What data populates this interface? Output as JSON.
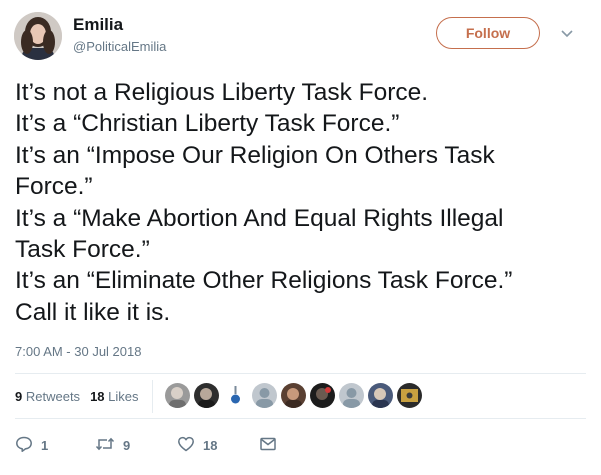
{
  "user": {
    "name": "Emilia",
    "handle": "@PoliticalEmilia"
  },
  "follow_label": "Follow",
  "tweet": {
    "lines": [
      "It’s not a Religious Liberty Task Force.",
      "It’s a “Christian Liberty Task Force.”",
      "It’s an “Impose Our Religion On Others Task",
      "Force.”",
      "It’s a “Make Abortion And Equal Rights Illegal",
      "Task Force.”",
      "It’s an “Eliminate Other Religions Task Force.”",
      "Call it like it is."
    ],
    "timestamp": "7:00 AM - 30 Jul 2018"
  },
  "stats": {
    "retweets_count": "9",
    "retweets_label": "Retweets",
    "likes_count": "18",
    "likes_label": "Likes"
  },
  "likers": [
    "liker-avatar-1",
    "liker-avatar-2",
    "liker-avatar-3",
    "liker-avatar-4",
    "liker-avatar-5",
    "liker-avatar-6",
    "liker-avatar-7",
    "liker-avatar-8",
    "liker-avatar-9"
  ],
  "actions": {
    "reply_count": "1",
    "retweet_count": "9",
    "like_count": "18"
  },
  "colors": {
    "follow_accent": "#c56f4d",
    "muted_text": "#657786",
    "primary_text": "#14171a",
    "divider": "#e6ecf0"
  },
  "icons": {
    "menu": "chevron-down-icon",
    "reply": "reply-icon",
    "retweet": "retweet-icon",
    "like": "heart-icon",
    "dm": "envelope-icon"
  }
}
